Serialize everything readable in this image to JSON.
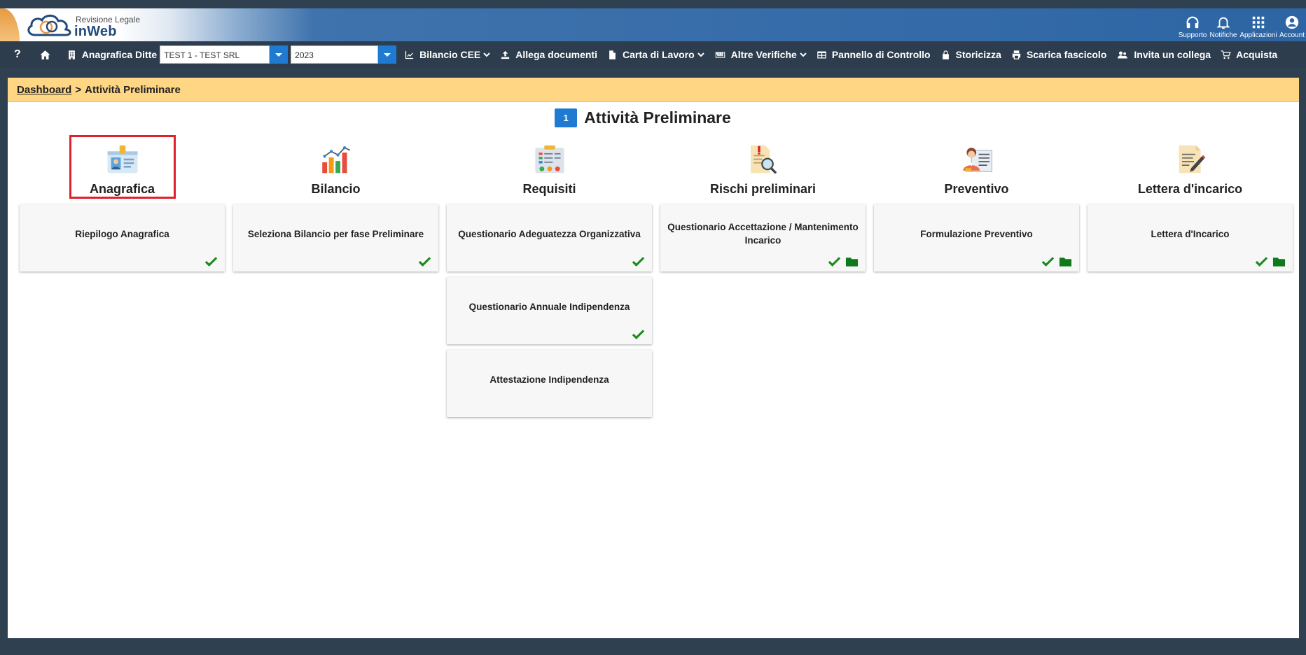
{
  "app": {
    "brand_sub": "Revisione Legale",
    "brand_main": "inWeb",
    "header_buttons": [
      {
        "label": "Supporto",
        "icon": "headset-icon"
      },
      {
        "label": "Notifiche",
        "icon": "bell-icon"
      },
      {
        "label": "Applicazioni",
        "icon": "grid-icon"
      },
      {
        "label": "Account",
        "icon": "user-circle-icon"
      }
    ]
  },
  "toolbar": {
    "help": "?",
    "anagrafica_ditte": "Anagrafica Ditte",
    "company_value": "TEST 1 - TEST SRL",
    "year_value": "2023",
    "bilancio_cee": "Bilancio CEE",
    "allega_documenti": "Allega documenti",
    "carta_di_lavoro": "Carta di Lavoro",
    "altre_verifiche": "Altre Verifiche",
    "pannello_di_controllo": "Pannello di Controllo",
    "storicizza": "Storicizza",
    "scarica_fascicolo": "Scarica fascicolo",
    "invita_un_collega": "Invita un collega",
    "acquista": "Acquista"
  },
  "breadcrumb": {
    "home": "Dashboard",
    "separator": ">",
    "current": "Attività Preliminare"
  },
  "section": {
    "number": "1",
    "title": "Attività Preliminare"
  },
  "categories": [
    {
      "name": "Anagrafica",
      "icon": "id-card-icon",
      "selected": true,
      "cards": [
        {
          "title": "Riepilogo Anagrafica",
          "done": true,
          "folder": false
        }
      ]
    },
    {
      "name": "Bilancio",
      "icon": "bar-chart-icon",
      "selected": false,
      "cards": [
        {
          "title": "Seleziona Bilancio per fase Preliminare",
          "done": true,
          "folder": false
        }
      ]
    },
    {
      "name": "Requisiti",
      "icon": "checklist-icon",
      "selected": false,
      "cards": [
        {
          "title": "Questionario Adeguatezza Organizzativa",
          "done": true,
          "folder": false
        },
        {
          "title": "Questionario Annuale Indipendenza",
          "done": true,
          "folder": false
        },
        {
          "title": "Attestazione Indipendenza",
          "done": false,
          "folder": false
        }
      ]
    },
    {
      "name": "Rischi preliminari",
      "icon": "risk-search-icon",
      "selected": false,
      "cards": [
        {
          "title": "Questionario Accettazione / Mantenimento Incarico",
          "done": true,
          "folder": true
        }
      ]
    },
    {
      "name": "Preventivo",
      "icon": "person-document-icon",
      "selected": false,
      "cards": [
        {
          "title": "Formulazione Preventivo",
          "done": true,
          "folder": true
        }
      ]
    },
    {
      "name": "Lettera d'incarico",
      "icon": "letter-pen-icon",
      "selected": false,
      "cards": [
        {
          "title": "Lettera d'Incarico",
          "done": true,
          "folder": true
        }
      ]
    }
  ],
  "colors": {
    "accent_blue": "#1f7ad1",
    "check_green": "#1a8a1a",
    "folder_green": "#0f7a1c",
    "breadcrumb_bg": "#ffd684",
    "selected_border": "#e0202a"
  }
}
